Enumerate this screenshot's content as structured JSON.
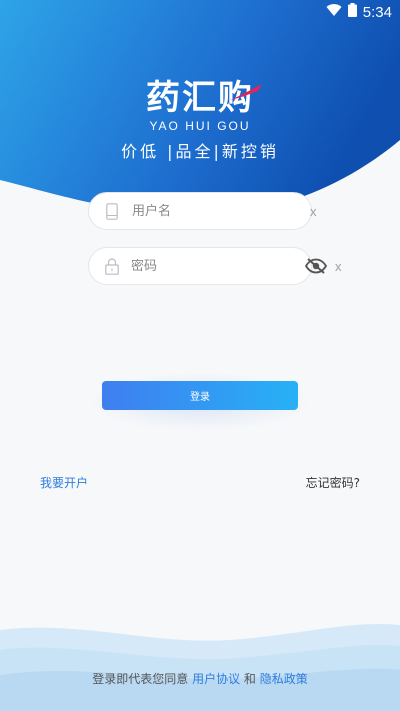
{
  "status_bar": {
    "time": "5:34",
    "wifi_icon": "wifi-icon",
    "battery_icon": "battery-icon"
  },
  "brand": {
    "logo_cn": "药汇购",
    "logo_en": "YAO HUI GOU",
    "slogan": "价低  |品全|新控销"
  },
  "form": {
    "username": {
      "placeholder": "用户名",
      "value": "",
      "icon": "phone-icon",
      "clear_label": "x"
    },
    "password": {
      "placeholder": "密码",
      "value": "",
      "icon": "lock-icon",
      "toggle_icon": "eye-off-icon",
      "clear_label": "x"
    },
    "login_label": "登录"
  },
  "links": {
    "register": "我要开户",
    "forgot": "忘记密码?"
  },
  "agreement": {
    "prefix": "登录即代表您同意",
    "user_agreement": "用户协议",
    "and": "和",
    "privacy_policy": "隐私政策"
  },
  "colors": {
    "brand_blue": "#1e6fd0",
    "link_blue": "#2f7ddd",
    "button_start": "#3f7ef0",
    "button_end": "#27b1f5"
  }
}
